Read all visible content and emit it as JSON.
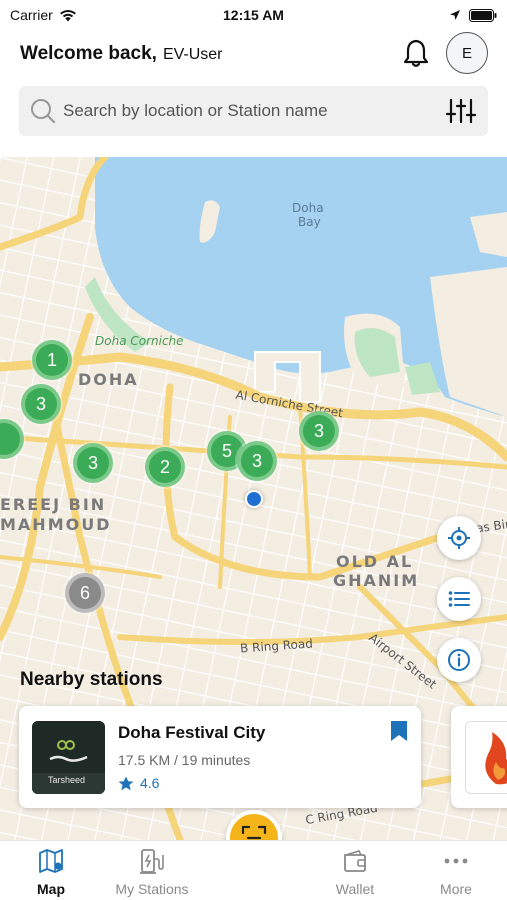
{
  "status_bar": {
    "carrier": "Carrier",
    "time": "12:15 AM"
  },
  "header": {
    "greeting": "Welcome back,",
    "username": "EV-User",
    "avatar_initial": "E"
  },
  "search": {
    "placeholder": "Search by location or Station name"
  },
  "map": {
    "districts": [
      "DOHA",
      "EREEJ BIN",
      "MAHMOUD",
      "OLD AL",
      "GHANIM"
    ],
    "roads": [
      "Al Corniche Street",
      "B Ring Road",
      "Airport Street",
      "C Ring Road",
      "as Bin"
    ],
    "water": [
      "Doha",
      "Bay"
    ],
    "park": "Doha Corniche",
    "clusters": [
      "1",
      "3",
      "3",
      "2",
      "5",
      "3",
      "3",
      "6"
    ],
    "colors": {
      "water": "#a6d2f2",
      "road": "#f6d47a",
      "park": "#bfe6c4",
      "cluster": "#3cab58",
      "cluster_grey": "#8a8a8a"
    }
  },
  "nearby": {
    "title": "Nearby stations",
    "stations": [
      {
        "name": "Doha Festival City",
        "distance": "17.5 KM / 19 minutes",
        "rating": "4.6",
        "logo_text": "Tarsheed"
      }
    ]
  },
  "tabs": [
    {
      "label": "Map",
      "icon": "map-icon",
      "active": true
    },
    {
      "label": "My Stations",
      "icon": "charging-station-icon",
      "active": false
    },
    {
      "label": "Wallet",
      "icon": "wallet-icon",
      "active": false
    },
    {
      "label": "More",
      "icon": "more-dots-icon",
      "active": false
    }
  ],
  "accent_color": "#f4b41a"
}
